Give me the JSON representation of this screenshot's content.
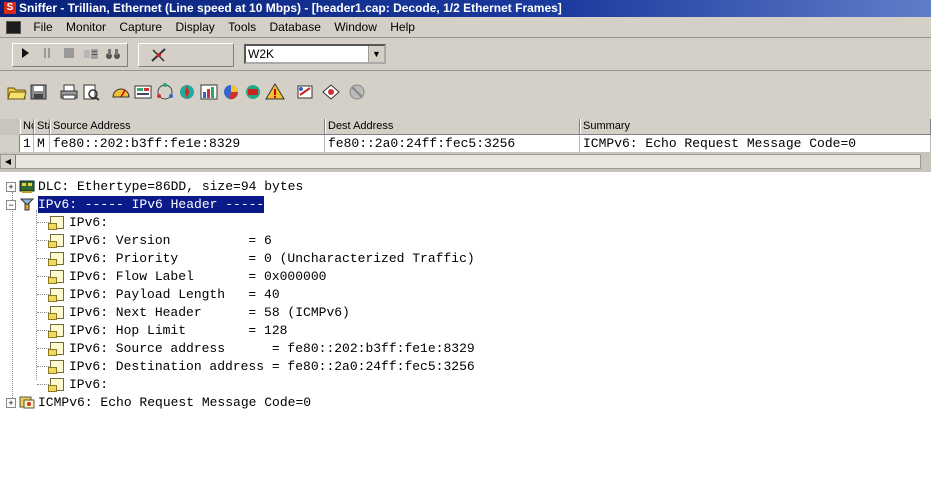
{
  "window": {
    "title": "Sniffer - Trillian, Ethernet (Line speed at 10 Mbps) - [header1.cap: Decode, 1/2 Ethernet Frames]"
  },
  "menu": [
    "File",
    "Monitor",
    "Capture",
    "Display",
    "Tools",
    "Database",
    "Window",
    "Help"
  ],
  "toolbar": {
    "profile_value": "W2K"
  },
  "packet_list": {
    "columns": [
      "No.",
      "Stat",
      "Source Address",
      "Dest Address",
      "Summary"
    ],
    "rows": [
      {
        "no": "1",
        "stat": "M",
        "source": "fe80::202:b3ff:fe1e:8329",
        "dest": "fe80::2a0:24ff:fec5:3256",
        "summary": "ICMPv6: Echo Request Message Code=0"
      }
    ]
  },
  "decode_tree": {
    "dlc": "DLC: Ethertype=86DD, size=94 bytes",
    "ipv6_header": "IPv6: ----- IPv6 Header -----",
    "ipv6_lines": [
      "IPv6:",
      "IPv6: Version          = 6",
      "IPv6: Priority         = 0 (Uncharacterized Traffic)",
      "IPv6: Flow Label       = 0x000000",
      "IPv6: Payload Length   = 40",
      "IPv6: Next Header      = 58 (ICMPv6)",
      "IPv6: Hop Limit        = 128",
      "IPv6: Source address      = fe80::202:b3ff:fe1e:8329",
      "IPv6: Destination address = fe80::2a0:24ff:fec5:3256",
      "IPv6:"
    ],
    "icmpv6": "ICMPv6: Echo Request Message Code=0"
  }
}
